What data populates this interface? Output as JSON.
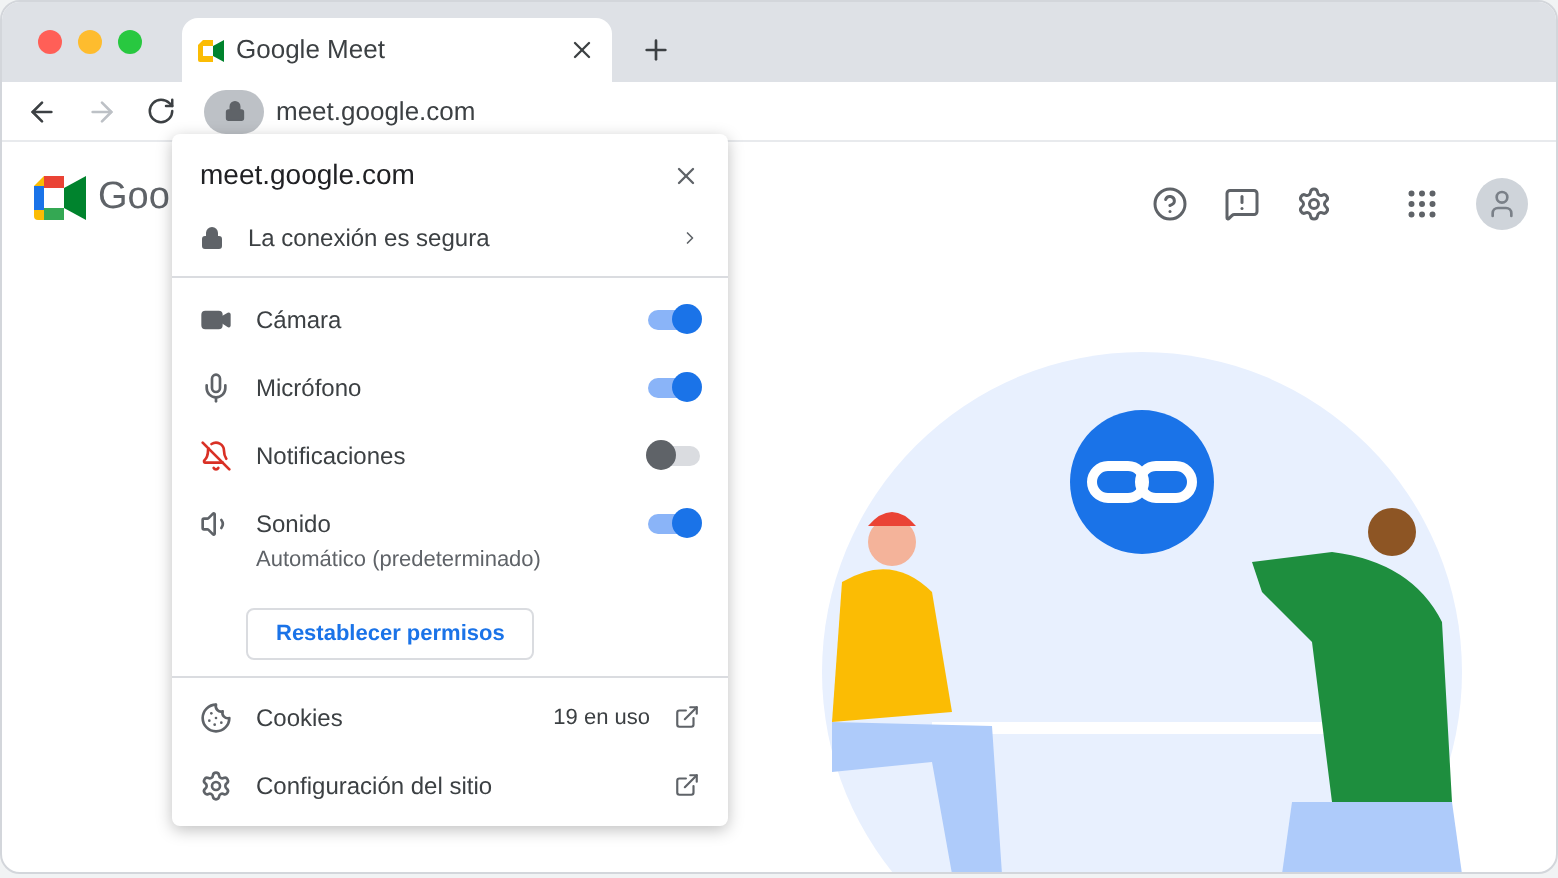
{
  "tab": {
    "title": "Google Meet"
  },
  "address_bar": {
    "url": "meet.google.com"
  },
  "page": {
    "logo_text": "Goo"
  },
  "site_popup": {
    "title": "meet.google.com",
    "connection": "La conexión es segura",
    "permissions": [
      {
        "kind": "camera",
        "label": "Cámara",
        "on": true
      },
      {
        "kind": "microphone",
        "label": "Micrófono",
        "on": true
      },
      {
        "kind": "notifications",
        "label": "Notificaciones",
        "on": false
      },
      {
        "kind": "sound",
        "label": "Sonido",
        "on": true,
        "detail": "Automático (predeterminado)"
      }
    ],
    "reset_button": "Restablecer permisos",
    "links": [
      {
        "kind": "cookies",
        "label": "Cookies",
        "count": "19 en uso"
      },
      {
        "kind": "settings",
        "label": "Configuración del sitio"
      }
    ]
  }
}
